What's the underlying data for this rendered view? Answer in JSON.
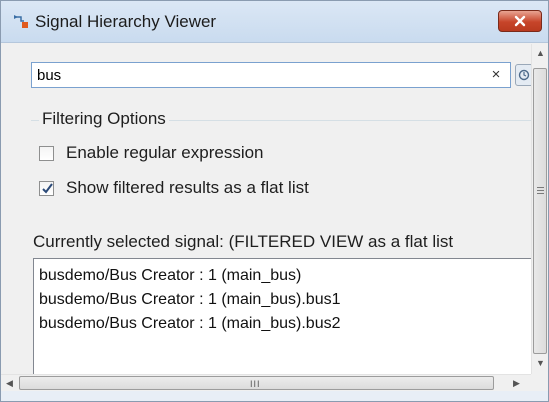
{
  "window": {
    "title": "Signal Hierarchy Viewer"
  },
  "search": {
    "value": "bus",
    "clear_glyph": "×"
  },
  "filtering": {
    "title": "Filtering Options",
    "options": [
      {
        "label": "Enable regular expression",
        "checked": false
      },
      {
        "label": "Show filtered results as a flat list",
        "checked": true
      }
    ]
  },
  "selected": {
    "label": "Currently selected signal: (FILTERED VIEW as a flat list"
  },
  "results": {
    "items": [
      "busdemo/Bus Creator : 1 (main_bus)",
      "busdemo/Bus Creator : 1 (main_bus).bus1",
      "busdemo/Bus Creator : 1 (main_bus).bus2"
    ]
  },
  "scrollbar": {
    "h_grip": "III"
  },
  "colors": {
    "title_bar": "#c9dbef",
    "close_button": "#c7452a",
    "search_border": "#7aa1cf",
    "group_line": "#d5dfe5"
  }
}
